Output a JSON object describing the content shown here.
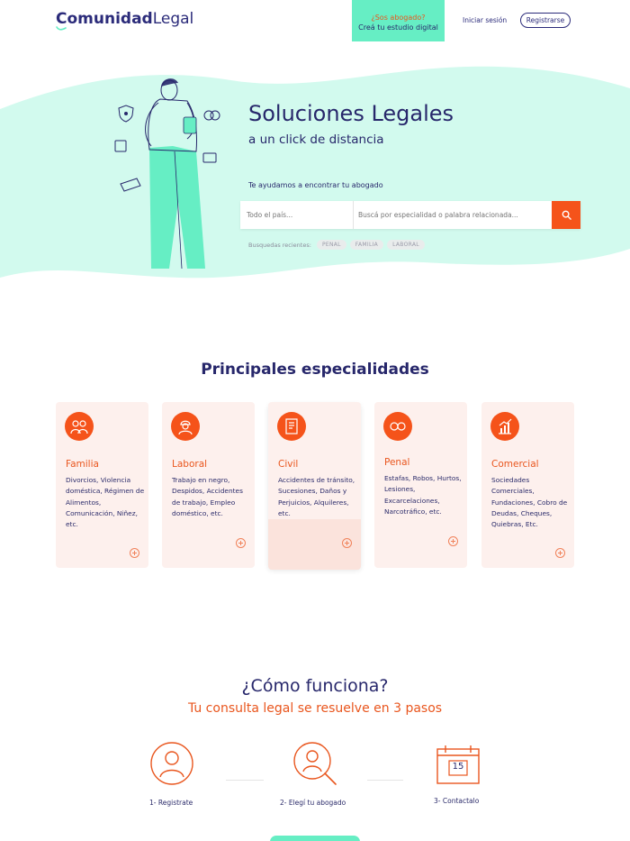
{
  "header": {
    "logo_bold": "Comunidad",
    "logo_light": "Legal",
    "lawyer_cta_question": "¿Sos abogado?",
    "lawyer_cta_sub": "Creá tu estudio digital",
    "login": "Iniciar sesión",
    "register": "Registrarse"
  },
  "hero": {
    "title": "Soluciones Legales",
    "subtitle": "a un click de distancia",
    "help_text": "Te ayudamos a encontrar tu abogado",
    "search": {
      "country_placeholder": "Todo el país...",
      "query_placeholder": "Buscá por especialidad o palabra relacionada..."
    },
    "recent_label": "Busquedas recientes:",
    "recent_chips": [
      "PENAL",
      "FAMILIA",
      "LABORAL"
    ]
  },
  "specialties": {
    "title": "Principales especialidades",
    "items": [
      {
        "name": "Familia",
        "desc": "Divorcios, Violencia doméstica, Régimen de Alimentos, Comunicación, Niñez, etc.",
        "icon": "family-icon"
      },
      {
        "name": "Laboral",
        "desc": "Trabajo en negro, Despidos, Accidentes de trabajo, Empleo doméstico, etc.",
        "icon": "worker-icon"
      },
      {
        "name": "Civil",
        "desc": "Accidentes de tránsito, Sucesiones, Daños y Perjuicios, Alquileres, etc.",
        "icon": "document-icon"
      },
      {
        "name": "Penal",
        "desc": "Estafas, Robos, Hurtos, Lesiones, Excarcelaciones, Narcotráfico, etc.",
        "icon": "handcuffs-icon"
      },
      {
        "name": "Comercial",
        "desc": "Sociedades Comerciales, Fundaciones, Cobro de Deudas, Cheques, Quiebras, Etc.",
        "icon": "growth-chart-icon"
      }
    ]
  },
  "how": {
    "title": "¿Cómo funciona?",
    "subtitle": "Tu consulta legal se resuelve en 3 pasos",
    "steps": [
      {
        "label": "1- Registrate",
        "icon": "user-circle-icon"
      },
      {
        "label": "2- Elegí tu abogado",
        "icon": "search-user-icon"
      },
      {
        "label": "3- Contactalo",
        "icon": "calendar-icon",
        "calendar_day": "15"
      }
    ]
  },
  "colors": {
    "navy": "#27276b",
    "orange": "#f5531a",
    "mint": "#66eec4",
    "mint_light": "#d2faee",
    "card_bg": "#fdf0ed"
  }
}
